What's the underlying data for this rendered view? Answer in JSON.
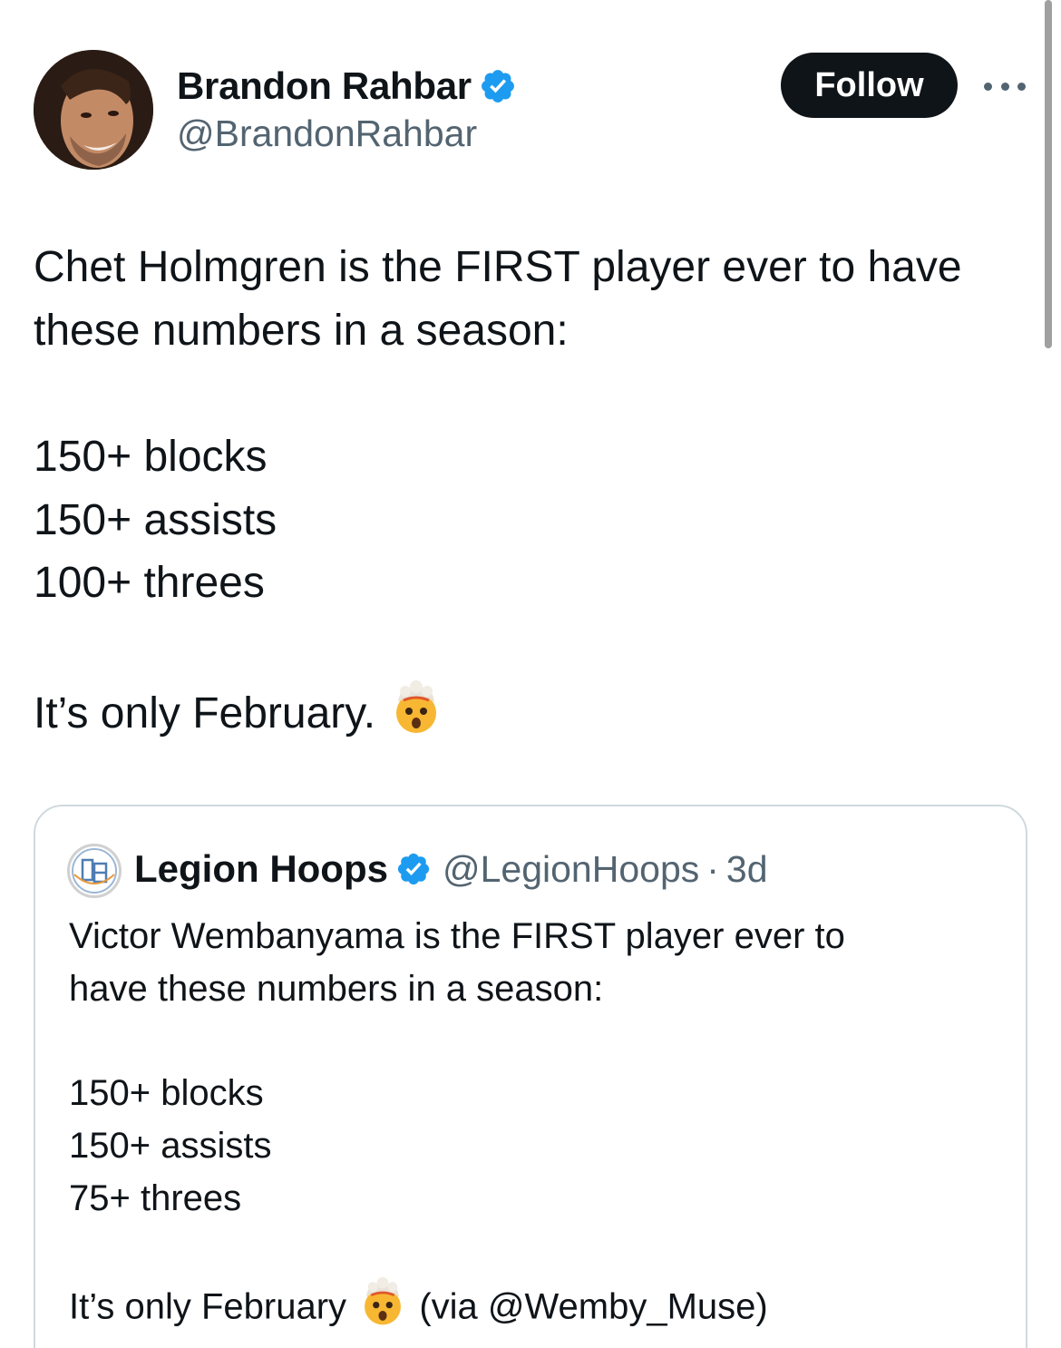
{
  "author": {
    "display_name": "Brandon Rahbar",
    "handle": "@BrandonRahbar",
    "verified": true,
    "verified_color": "#1d9bf0"
  },
  "actions": {
    "follow_label": "Follow",
    "more_icon": "more-horizontal-icon"
  },
  "tweet": {
    "line1": "Chet Holmgren is the FIRST player ever to have",
    "line2": "these numbers in a season:",
    "stat1": "150+ blocks",
    "stat2": "150+ assists",
    "stat3": "100+ threes",
    "closing": "It’s only February.",
    "closing_emoji": "🤯"
  },
  "quoted_tweet": {
    "display_name": "Legion Hoops",
    "handle": "@LegionHoops",
    "separator": "·",
    "time": "3d",
    "verified": true,
    "line1": "Victor Wembanyama is the FIRST player ever to",
    "line2": "have these numbers in a season:",
    "stat1": "150+ blocks",
    "stat2": "150+ assists",
    "stat3": "75+ threes",
    "closing_text": "It’s only February",
    "closing_emoji": "🤯",
    "closing_via": "(via @Wemby_Muse)"
  },
  "colors": {
    "text_primary": "#0f1419",
    "text_secondary": "#536471",
    "follow_bg": "#0f1419",
    "border": "#cfd9de"
  }
}
